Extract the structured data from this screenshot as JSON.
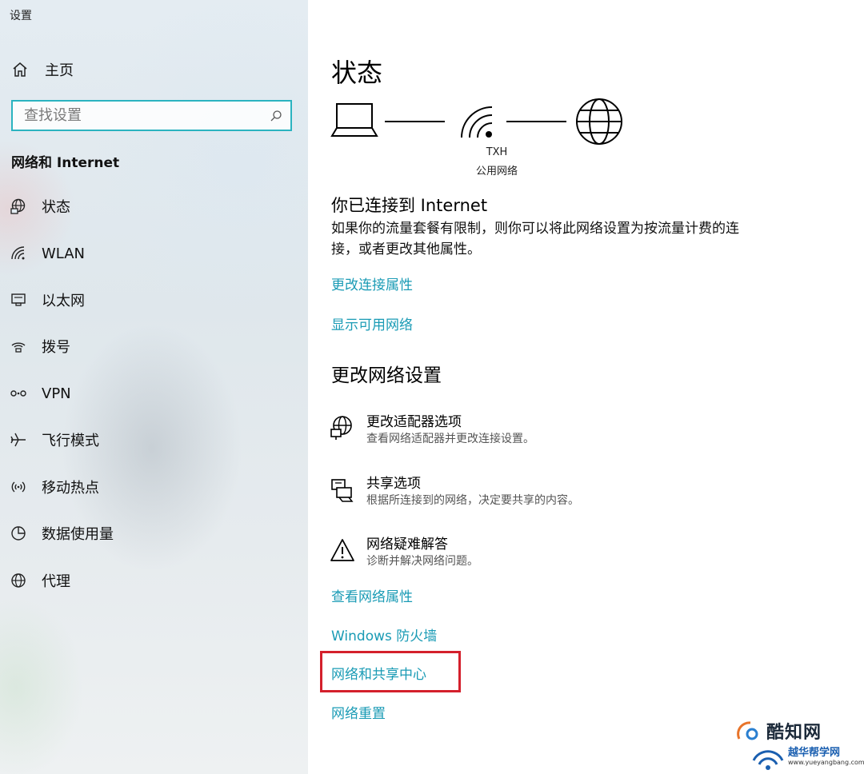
{
  "window": {
    "title": "设置"
  },
  "sidebar": {
    "home_label": "主页",
    "search_placeholder": "查找设置",
    "section_title": "网络和 Internet",
    "items": [
      {
        "label": "状态",
        "icon": "globe-status-icon"
      },
      {
        "label": "WLAN",
        "icon": "wifi-icon"
      },
      {
        "label": "以太网",
        "icon": "ethernet-icon"
      },
      {
        "label": "拨号",
        "icon": "dialup-icon"
      },
      {
        "label": "VPN",
        "icon": "vpn-icon"
      },
      {
        "label": "飞行模式",
        "icon": "airplane-icon"
      },
      {
        "label": "移动热点",
        "icon": "hotspot-icon"
      },
      {
        "label": "数据使用量",
        "icon": "data-usage-icon"
      },
      {
        "label": "代理",
        "icon": "globe-icon"
      }
    ]
  },
  "main": {
    "title": "状态",
    "network": {
      "name": "TXH",
      "type": "公用网络"
    },
    "status_heading": "你已连接到 Internet",
    "status_description": "如果你的流量套餐有限制，则你可以将此网络设置为按流量计费的连接，或者更改其他属性。",
    "links_top": [
      "更改连接属性",
      "显示可用网络"
    ],
    "change_heading": "更改网络设置",
    "options": [
      {
        "title": "更改适配器选项",
        "desc": "查看网络适配器并更改连接设置。",
        "icon": "adapter-icon"
      },
      {
        "title": "共享选项",
        "desc": "根据所连接到的网络，决定要共享的内容。",
        "icon": "sharing-icon"
      },
      {
        "title": "网络疑难解答",
        "desc": "诊断并解决网络问题。",
        "icon": "warning-icon"
      }
    ],
    "links_bottom": [
      "查看网络属性",
      "Windows 防火墙",
      "网络和共享中心",
      "网络重置"
    ]
  },
  "watermark": {
    "line1": "酷知网",
    "line2": "越华帮学网",
    "line3": "www.yueyangbang.com"
  },
  "colors": {
    "accent": "#1a9bb5",
    "search_border": "#2bb3c0",
    "highlight": "#d4202c"
  }
}
